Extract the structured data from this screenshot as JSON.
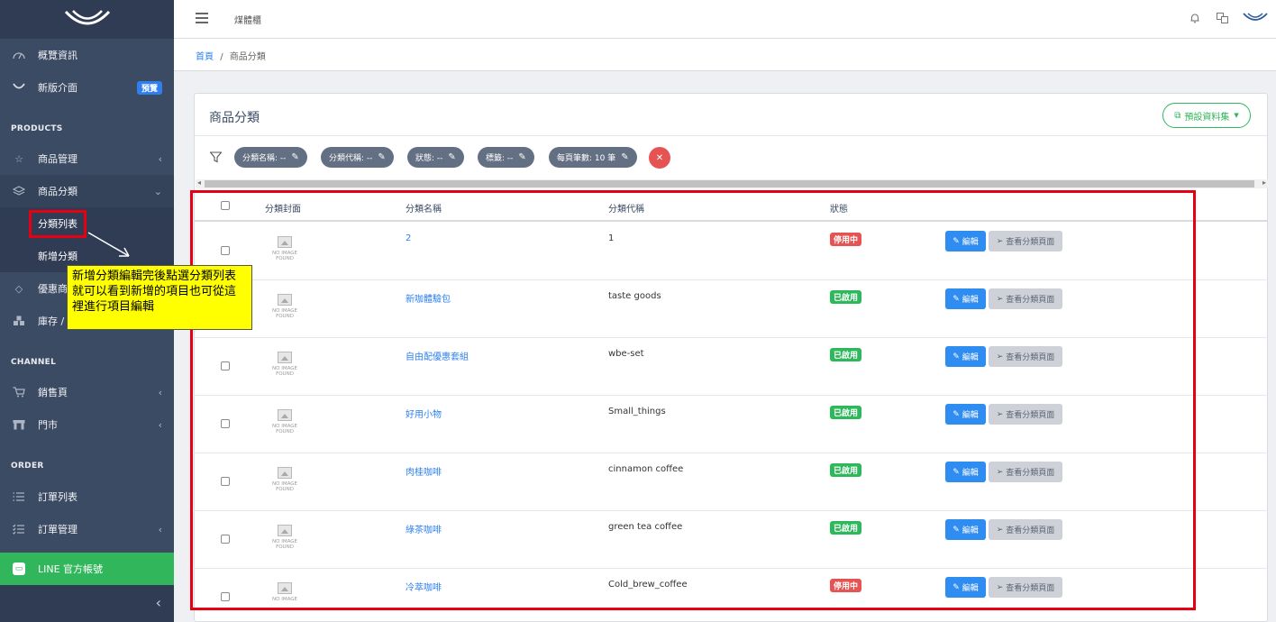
{
  "sidebar": {
    "items": [
      {
        "label": "概覽資訊",
        "icon": "speedometer-icon"
      },
      {
        "label": "新版介面",
        "icon": "logo-mark-icon",
        "badge": "預覽"
      },
      {
        "label": "商品管理",
        "icon": "star-icon"
      },
      {
        "label": "商品分類",
        "icon": "layers-icon"
      },
      {
        "label": "優惠商",
        "icon": "diamond-icon"
      },
      {
        "label": "庫存 /",
        "icon": "boxes-icon"
      },
      {
        "label": "銷售頁",
        "icon": "cart-icon"
      },
      {
        "label": "門市",
        "icon": "store-icon"
      },
      {
        "label": "訂單列表",
        "icon": "list-icon"
      },
      {
        "label": "訂單管理",
        "icon": "checklist-icon"
      }
    ],
    "sections": {
      "products": "PRODUCTS",
      "channel": "CHANNEL",
      "order": "ORDER"
    },
    "sub_items": {
      "category_list": "分類列表",
      "new_category": "新增分類"
    },
    "line_account": "LINE 官方帳號"
  },
  "header": {
    "brand": "煤體櫃"
  },
  "breadcrumb": {
    "home": "首頁",
    "separator": "/",
    "current": "商品分類"
  },
  "card": {
    "title": "商品分類",
    "preset_button": "預設資料集",
    "filters": [
      "分類名稱: --",
      "分類代稱: --",
      "狀態: --",
      "標籤: --",
      "每頁筆數: 10 筆"
    ]
  },
  "table": {
    "headers": {
      "cover": "分類封面",
      "name": "分類名稱",
      "code": "分類代稱",
      "status": "狀態"
    },
    "no_image": {
      "line1": "NO IMAGE",
      "line2": "FOUND"
    },
    "edit_label": "編輯",
    "view_label": "查看分類頁面",
    "rows": [
      {
        "name": "2",
        "code": "1",
        "status": "停用中",
        "active": false
      },
      {
        "name": "新咖體驗包",
        "code": "taste goods",
        "status": "已啟用",
        "active": true
      },
      {
        "name": "自由配優惠套組",
        "code": "wbe-set",
        "status": "已啟用",
        "active": true
      },
      {
        "name": "好用小物",
        "code": "Small_things",
        "status": "已啟用",
        "active": true
      },
      {
        "name": "肉桂咖啡",
        "code": "cinnamon coffee",
        "status": "已啟用",
        "active": true
      },
      {
        "name": "綠茶咖啡",
        "code": "green tea coffee",
        "status": "已啟用",
        "active": true
      },
      {
        "name": "冷萃咖啡",
        "code": "Cold_brew_coffee",
        "status": "停用中",
        "active": false
      }
    ]
  },
  "annotation": {
    "note": "新增分類編輯完後點選分類列表就可以看到新增的項目也可從這裡進行項目編輯"
  },
  "colors": {
    "sidebar": "#3c4b64",
    "accent": "#2f80ed",
    "success": "#2eb85c",
    "danger": "#e55353",
    "annotation_red": "#e60012",
    "note_yellow": "#ffff00"
  }
}
